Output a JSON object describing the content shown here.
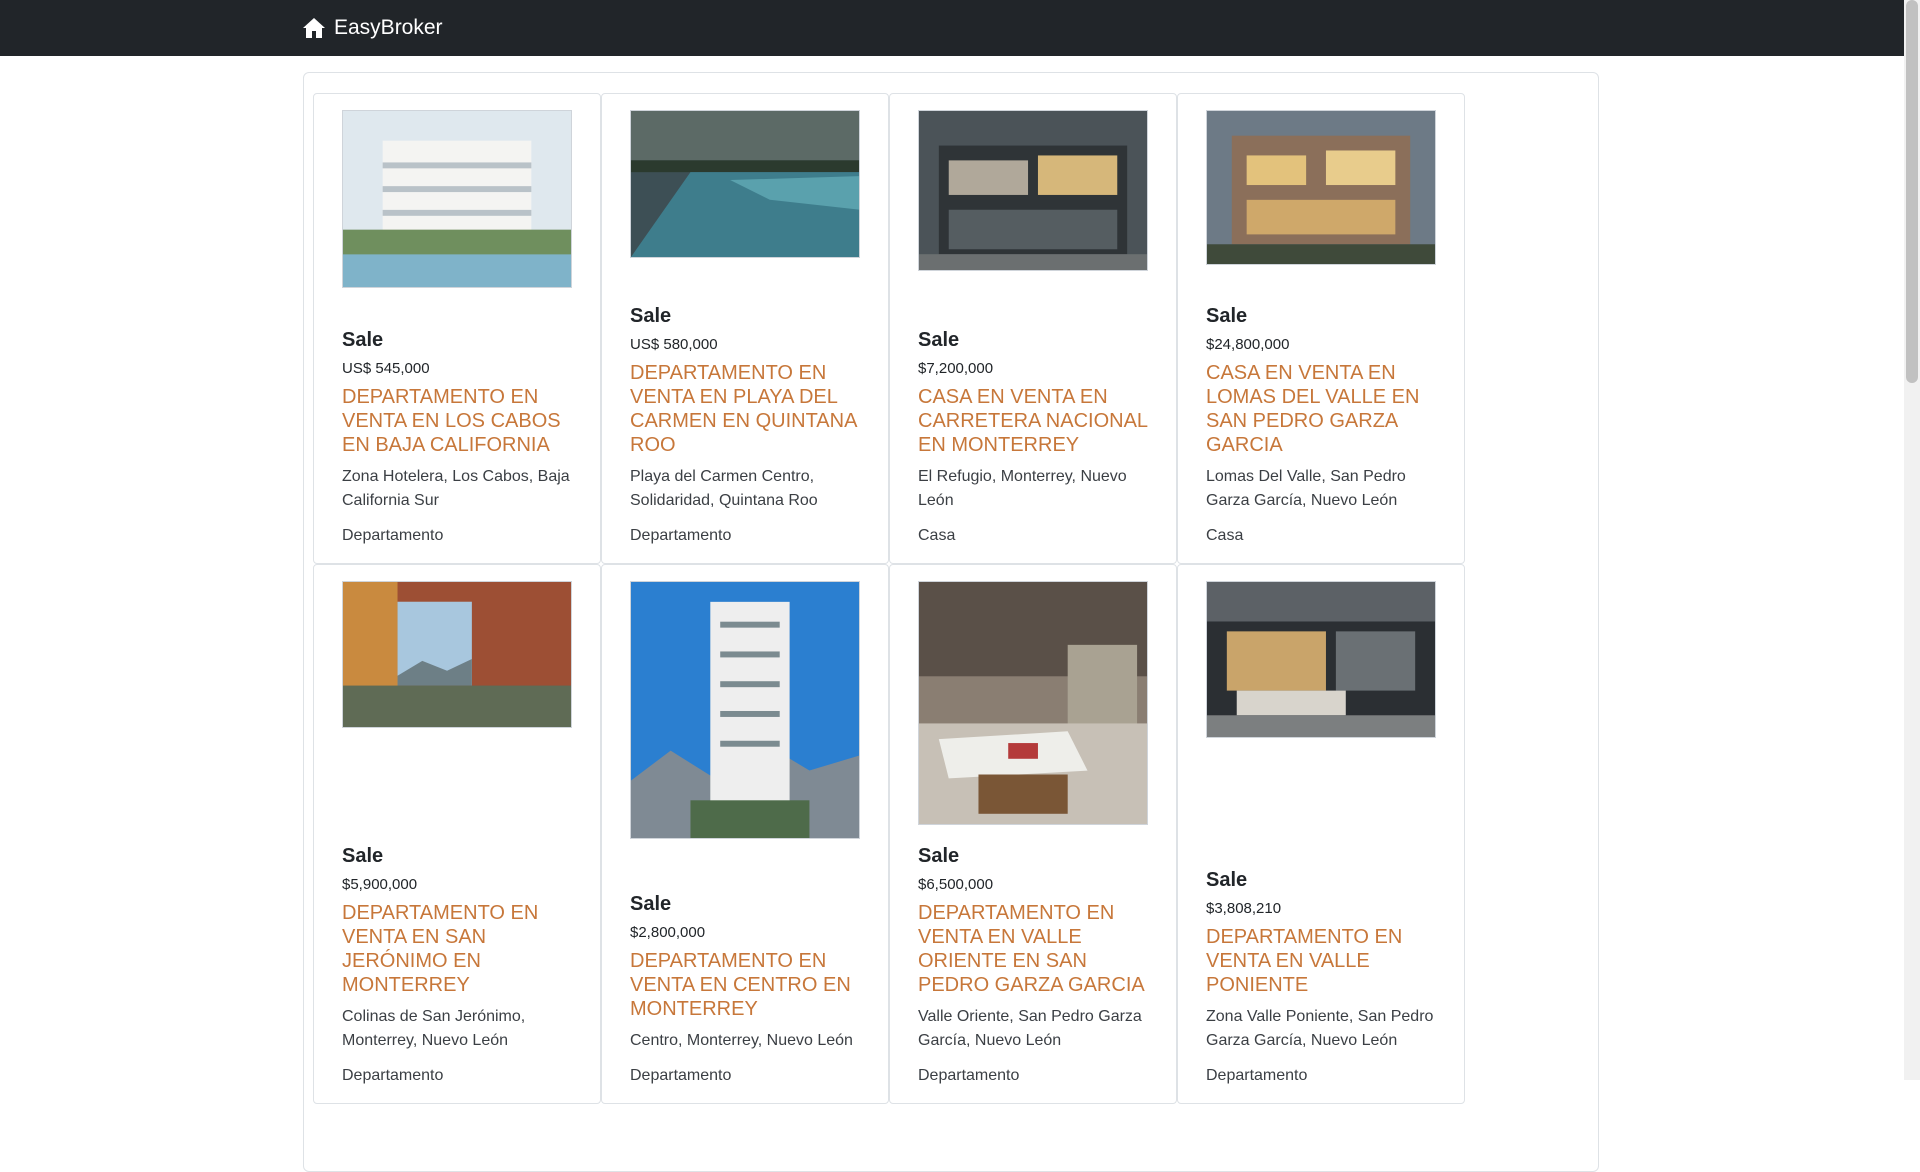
{
  "navbar": {
    "brand": "EasyBroker",
    "brand_icon": "home-icon"
  },
  "colors": {
    "navbar_bg": "#212529",
    "title_link": "#c7773a"
  },
  "listings": [
    {
      "operation": "Sale",
      "price": "US$ 545,000",
      "title": "DEPARTAMENTO EN VENTA EN LOS CABOS EN BAJA CALIFORNIA",
      "location": "Zona Hotelera, Los Cabos, Baja California Sur",
      "type": "Departamento",
      "image": "white modern condo building with pool"
    },
    {
      "operation": "Sale",
      "price": "US$ 580,000",
      "title": "DEPARTAMENTO EN VENTA EN PLAYA DEL CARMEN EN QUINTANA ROO",
      "location": "Playa del Carmen Centro, Solidaridad, Quintana Roo",
      "type": "Departamento",
      "image": "long pool with palm trees at dusk"
    },
    {
      "operation": "Sale",
      "price": "$7,200,000",
      "title": "CASA EN VENTA EN CARRETERA NACIONAL EN MONTERREY",
      "location": "El Refugio, Monterrey, Nuevo León",
      "type": "Casa",
      "image": "modern dark house facade at night"
    },
    {
      "operation": "Sale",
      "price": "$24,800,000",
      "title": "CASA EN VENTA EN LOMAS DEL VALLE EN SAN PEDRO GARZA GARCIA",
      "location": "Lomas Del Valle, San Pedro Garza García, Nuevo León",
      "type": "Casa",
      "image": "two-storey modern house at dusk"
    },
    {
      "operation": "Sale",
      "price": "$5,900,000",
      "title": "DEPARTAMENTO EN VENTA EN SAN JERÓNIMO EN MONTERREY",
      "location": "Colinas de San Jerónimo, Monterrey, Nuevo León",
      "type": "Departamento",
      "image": "brick towers with mountain view"
    },
    {
      "operation": "Sale",
      "price": "$2,800,000",
      "title": "DEPARTAMENTO EN VENTA EN CENTRO EN MONTERREY",
      "location": "Centro, Monterrey, Nuevo León",
      "type": "Departamento",
      "image": "white residential tower against blue sky"
    },
    {
      "operation": "Sale",
      "price": "$6,500,000",
      "title": "DEPARTAMENTO EN VENTA EN VALLE ORIENTE EN SAN PEDRO GARZA GARCIA",
      "location": "Valle Oriente, San Pedro Garza García, Nuevo León",
      "type": "Departamento",
      "image": "living room with white sofa"
    },
    {
      "operation": "Sale",
      "price": "$3,808,210",
      "title": "DEPARTAMENTO EN VENTA EN VALLE PONIENTE",
      "location": "Zona Valle Poniente, San Pedro Garza García, Nuevo León",
      "type": "Departamento",
      "image": "covered terrace lounge at night"
    }
  ]
}
